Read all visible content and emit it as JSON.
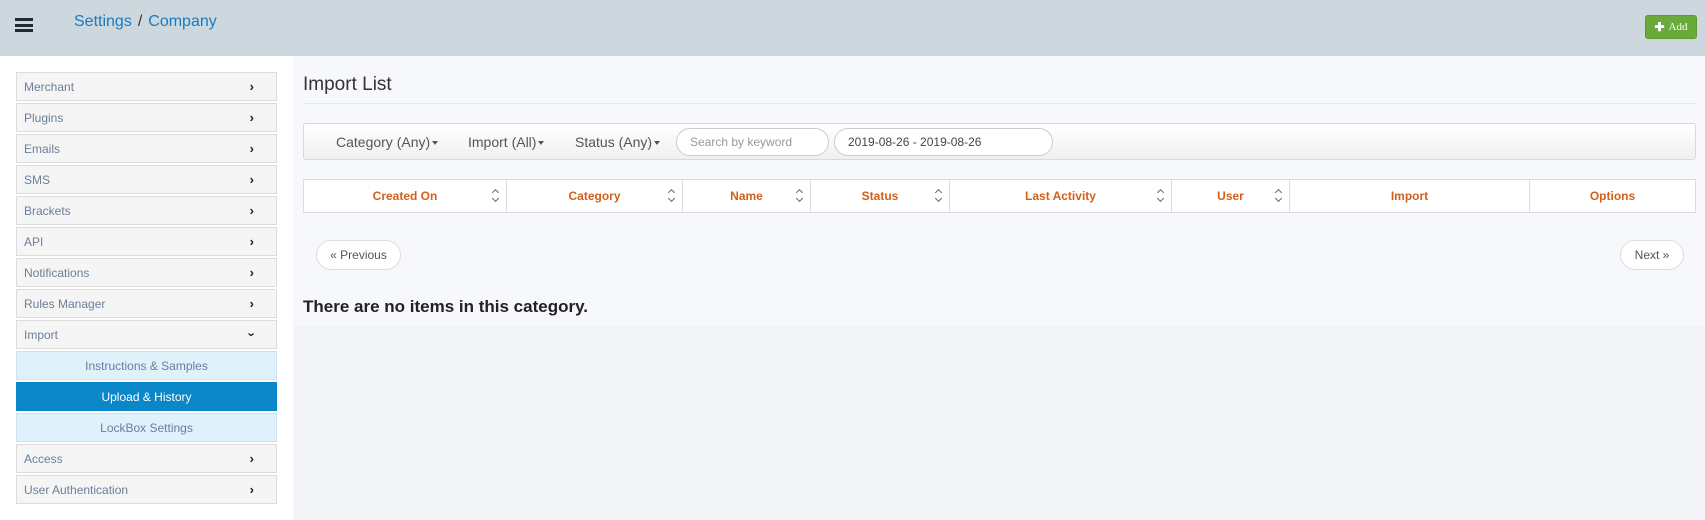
{
  "header": {
    "breadcrumb": [
      "Settings",
      "Company"
    ],
    "breadcrumb_separator": "/",
    "add_label": "Add",
    "add_icon": "plus-icon",
    "menu_icon": "list-icon"
  },
  "sidebar": {
    "items": [
      {
        "label": "Merchant",
        "icon": "chevron-right-icon"
      },
      {
        "label": "Plugins",
        "icon": "chevron-right-icon"
      },
      {
        "label": "Emails",
        "icon": "chevron-right-icon"
      },
      {
        "label": "SMS",
        "icon": "chevron-right-icon"
      },
      {
        "label": "Brackets",
        "icon": "chevron-right-icon"
      },
      {
        "label": "API",
        "icon": "chevron-right-icon"
      },
      {
        "label": "Notifications",
        "icon": "chevron-right-icon"
      },
      {
        "label": "Rules Manager",
        "icon": "chevron-right-icon"
      },
      {
        "label": "Import",
        "icon": "chevron-down-icon",
        "expanded": true
      }
    ],
    "subitems": [
      {
        "label": "Instructions & Samples",
        "active": false
      },
      {
        "label": "Upload & History",
        "active": true
      },
      {
        "label": "LockBox Settings",
        "active": false
      }
    ],
    "items_after": [
      {
        "label": "Access",
        "icon": "chevron-right-icon"
      },
      {
        "label": "User Authentication",
        "icon": "chevron-right-icon"
      }
    ]
  },
  "main": {
    "title": "Import List",
    "filters": {
      "category": "Category (Any)",
      "import": "Import (All)",
      "status": "Status (Any)",
      "search_placeholder": "Search by keyword",
      "date_range": "2019-08-26 - 2019-08-26"
    },
    "table": {
      "columns": [
        "Created On",
        "Category",
        "Name",
        "Status",
        "Last Activity",
        "User",
        "Import",
        "Options"
      ],
      "sortable": [
        true,
        true,
        true,
        true,
        true,
        true,
        false,
        false
      ]
    },
    "pagination": {
      "previous": "« Previous",
      "next": "Next »"
    },
    "empty_message": "There are no items in this category."
  },
  "colors": {
    "topbar": "#cdd8de",
    "link": "#1a7bc0",
    "add_button": "#6aaa3b",
    "active_subitem": "#0a86c9",
    "subitem_bg": "#dff1fb",
    "column_header": "#d35f1a"
  }
}
